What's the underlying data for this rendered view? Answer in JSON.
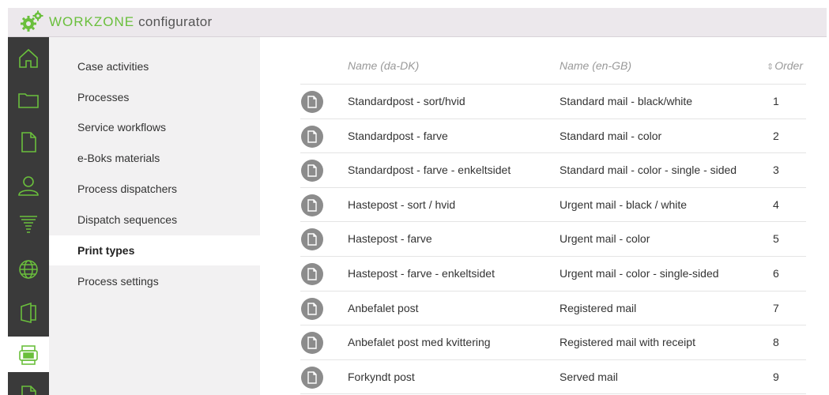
{
  "app": {
    "brand": "WORKZONE",
    "subtitle": " configurator"
  },
  "rail": {
    "items": [
      {
        "icon": "home-icon"
      },
      {
        "icon": "folder-icon"
      },
      {
        "icon": "document-icon"
      },
      {
        "icon": "user-icon"
      },
      {
        "icon": "filter-icon"
      },
      {
        "icon": "globe-icon"
      },
      {
        "icon": "office-icon"
      },
      {
        "icon": "print-configurator-icon",
        "active": true
      },
      {
        "icon": "document-partial-icon"
      }
    ]
  },
  "subnav": {
    "items": [
      {
        "label": "Case activities"
      },
      {
        "label": "Processes"
      },
      {
        "label": "Service workflows"
      },
      {
        "label": "e-Boks materials"
      },
      {
        "label": "Process dispatchers"
      },
      {
        "label": "Dispatch sequences"
      },
      {
        "label": "Print types",
        "active": true
      },
      {
        "label": "Process settings"
      }
    ]
  },
  "table": {
    "headers": {
      "name_da": "Name (da-DK)",
      "name_en": "Name (en-GB)",
      "order": "Order"
    },
    "rows": [
      {
        "name_da": "Standardpost - sort/hvid",
        "name_en": "Standard mail - black/white",
        "order": "1"
      },
      {
        "name_da": "Standardpost - farve",
        "name_en": "Standard mail - color",
        "order": "2"
      },
      {
        "name_da": "Standardpost - farve - enkeltsidet",
        "name_en": "Standard mail - color - single - sided",
        "order": "3"
      },
      {
        "name_da": "Hastepost - sort / hvid",
        "name_en": "Urgent mail - black / white",
        "order": "4"
      },
      {
        "name_da": "Hastepost - farve",
        "name_en": "Urgent mail - color",
        "order": "5"
      },
      {
        "name_da": "Hastepost - farve - enkeltsidet",
        "name_en": "Urgent mail - color - single-sided",
        "order": "6"
      },
      {
        "name_da": "Anbefalet post",
        "name_en": "Registered mail",
        "order": "7"
      },
      {
        "name_da": "Anbefalet post med kvittering",
        "name_en": "Registered mail with receipt",
        "order": "8"
      },
      {
        "name_da": "Forkyndt post",
        "name_en": "Served mail",
        "order": "9"
      }
    ]
  },
  "colors": {
    "accent": "#6abf3c",
    "rail_bg": "#3a3a3a",
    "subnav_bg": "#f2f1f2"
  }
}
